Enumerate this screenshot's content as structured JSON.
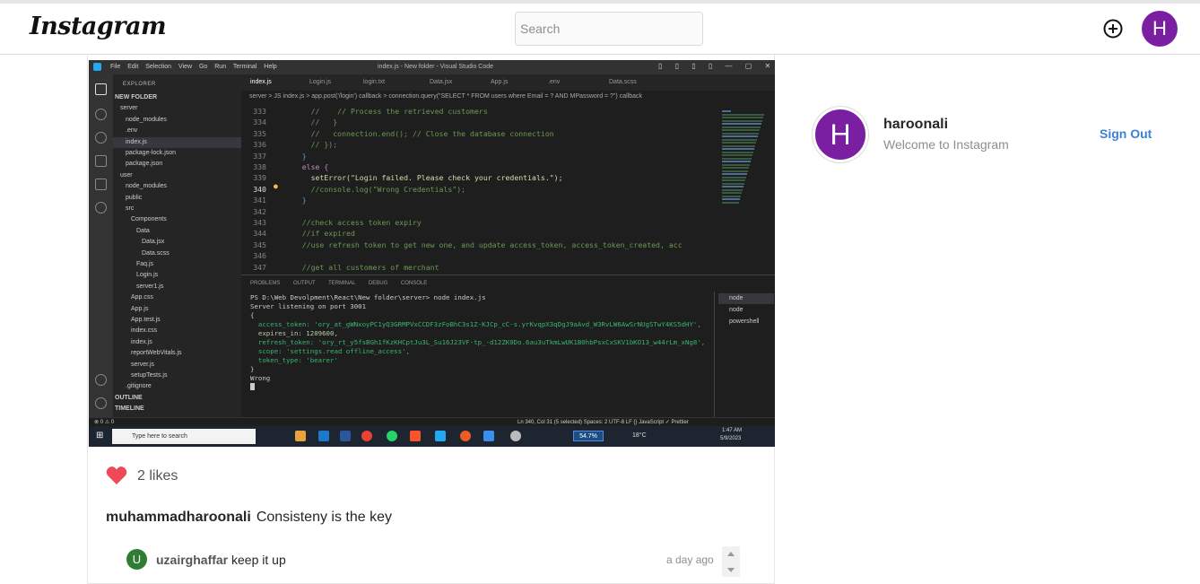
{
  "header": {
    "logo": "Instagram",
    "search_placeholder": "Search",
    "avatar_letter": "H"
  },
  "post": {
    "screenshot": {
      "window_title": "index.js - New folder - Visual Studio Code",
      "menu": "File Edit Selection View Go Run Terminal Help",
      "explorer_label": "EXPLORER",
      "tree": [
        {
          "label": "NEW FOLDER"
        },
        {
          "label": "server"
        },
        {
          "label": "node_modules"
        },
        {
          "label": ".env"
        },
        {
          "label": "index.js",
          "selected": true
        },
        {
          "label": "package-lock.json"
        },
        {
          "label": "package.json"
        },
        {
          "label": "user"
        },
        {
          "label": "node_modules"
        },
        {
          "label": "public"
        },
        {
          "label": "src"
        },
        {
          "label": "Components"
        },
        {
          "label": "Data"
        },
        {
          "label": "Data.jsx"
        },
        {
          "label": "Data.scss"
        },
        {
          "label": "Faq.js"
        },
        {
          "label": "Login.js"
        },
        {
          "label": "server1.js"
        },
        {
          "label": "App.css"
        },
        {
          "label": "App.js"
        },
        {
          "label": "App.test.js"
        },
        {
          "label": "index.css"
        },
        {
          "label": "index.js"
        },
        {
          "label": "reportWebVitals.js"
        },
        {
          "label": "server.js"
        },
        {
          "label": "setupTests.js"
        },
        {
          "label": ".gitignore"
        },
        {
          "label": "OUTLINE"
        },
        {
          "label": "TIMELINE"
        }
      ],
      "tabs": [
        "index.js",
        "Login.js",
        "login.txt",
        "Data.jsx",
        "App.js",
        ".env",
        "Data.scss"
      ],
      "breadcrumb": "server > JS index.js > app.post('/login') callback > connection.query(\"SELECT * FROM users where Email = ? AND MPassword = ?\") callback",
      "code": [
        {
          "n": "333",
          "t": "      //    // Process the retrieved customers",
          "c": "#6a9955"
        },
        {
          "n": "334",
          "t": "      //   }",
          "c": "#6a9955"
        },
        {
          "n": "335",
          "t": "      //   connection.end(); // Close the database connection",
          "c": "#6a9955"
        },
        {
          "n": "336",
          "t": "      // });",
          "c": "#6a9955"
        },
        {
          "n": "337",
          "t": "    }",
          "c": "#569cd6"
        },
        {
          "n": "338",
          "t": "    else {",
          "c": "#c586c0"
        },
        {
          "n": "339",
          "t": "      setError(\"Login failed. Please check your credentials.\");",
          "c": "#dcdcaa"
        },
        {
          "n": "340",
          "t": "      //console.log(\"Wrong Credentials\");",
          "c": "#6a9955"
        },
        {
          "n": "341",
          "t": "    }",
          "c": "#569cd6"
        },
        {
          "n": "342",
          "t": "",
          "c": "#ccc"
        },
        {
          "n": "343",
          "t": "    //check access token expiry",
          "c": "#6a9955"
        },
        {
          "n": "344",
          "t": "    //if expired",
          "c": "#6a9955"
        },
        {
          "n": "345",
          "t": "    //use refresh token to get new one, and update access_token, access_token_created, acc",
          "c": "#6a9955"
        },
        {
          "n": "346",
          "t": "",
          "c": "#ccc"
        },
        {
          "n": "347",
          "t": "    //get all customers of merchant",
          "c": "#6a9955"
        }
      ],
      "panel_tabs": "PROBLEMS OUTPUT TERMINAL DEBUG CONSOLE",
      "terminal": [
        {
          "t": "PS D:\\Web Devolpment\\React\\New folder\\server> node index.js",
          "c": "#cccccc"
        },
        {
          "t": "Server listening on port 3001",
          "c": "#cccccc"
        },
        {
          "t": "{",
          "c": "#cccccc"
        },
        {
          "t": "  access_token: 'ory_at_gWNxoyPC1yQ3GRMPVxCCDF3zFoBhC3s1Z-KJCp_cC-s.yrKvqpX3qDgJ9aAvd_W3RvLW6AwSrNUgSTwY4KS5dHY',",
          "c": "#3cb371"
        },
        {
          "t": "  expires_in: 1209600,",
          "c": "#b5cea8"
        },
        {
          "t": "  refresh_token: 'ory_rt_y5fsBGh1fKzKHCptJu3L_Su16J23VF-tp_-d12ZK0Do.6au3uTkmLwUK1B0hbPsxCxSKV1bKO13_w44rLm_xNg8',",
          "c": "#3cb371"
        },
        {
          "t": "  scope: 'settings.read offline_access',",
          "c": "#3cb371"
        },
        {
          "t": "  token_type: 'bearer'",
          "c": "#3cb371"
        },
        {
          "t": "}",
          "c": "#cccccc"
        },
        {
          "t": "Wrong",
          "c": "#cccccc"
        }
      ],
      "terminal_sessions": [
        "node",
        "node",
        "powershell"
      ],
      "status_left": "⊗ 0 ⚠ 0",
      "status_right": "Ln 340, Col 31 (5 selected)   Spaces: 2   UTF-8   LF   {} JavaScript   ✓ Prettier",
      "taskbar_search": "Type here to search",
      "taskbar_percent": "54.7%",
      "weather": "18°C",
      "clock_time": "1:47 AM",
      "clock_date": "5/9/2023"
    },
    "likes": "2 likes",
    "caption_user": "muhammadharoonali",
    "caption_text": "Consisteny is the key",
    "comment": {
      "avatar_letter": "U",
      "user": "uzairghaffar",
      "text": "keep it up",
      "time": "a day ago"
    }
  },
  "profile": {
    "avatar_letter": "H",
    "username": "haroonali",
    "subtitle": "Welcome to Instagram",
    "signout_label": "Sign Out"
  },
  "colors": {
    "avatar_purple": "#7b1fa2",
    "comment_avatar_green": "#2e7d32",
    "heart_red": "#ed4956",
    "link_blue": "#3b82d4"
  }
}
